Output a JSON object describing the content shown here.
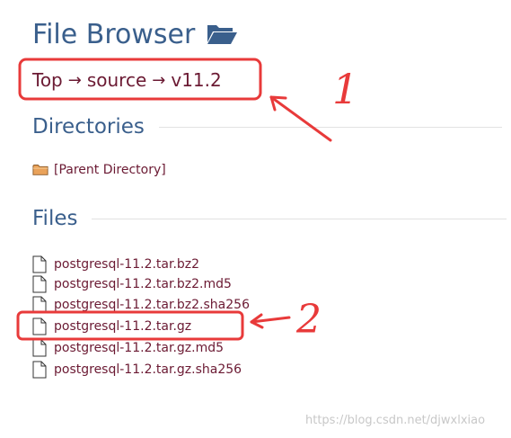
{
  "header": {
    "title": "File Browser",
    "folder_icon": "folder-open-icon",
    "title_color": "#3a5f8c"
  },
  "breadcrumb": {
    "items": [
      "Top",
      "source",
      "v11.2"
    ],
    "separator": "→",
    "link_color": "#6b1a33"
  },
  "directories": {
    "heading": "Directories",
    "items": [
      {
        "label": "[Parent Directory]",
        "icon": "folder-icon"
      }
    ]
  },
  "files": {
    "heading": "Files",
    "items": [
      {
        "label": "postgresql-11.2.tar.bz2",
        "icon": "file-icon"
      },
      {
        "label": "postgresql-11.2.tar.bz2.md5",
        "icon": "file-icon"
      },
      {
        "label": "postgresql-11.2.tar.bz2.sha256",
        "icon": "file-icon"
      },
      {
        "label": "postgresql-11.2.tar.gz",
        "icon": "file-icon"
      },
      {
        "label": "postgresql-11.2.tar.gz.md5",
        "icon": "file-icon"
      },
      {
        "label": "postgresql-11.2.tar.gz.sha256",
        "icon": "file-icon"
      }
    ]
  },
  "annotations": {
    "color": "#e83a3a",
    "marks": [
      "1",
      "2"
    ]
  },
  "watermark": "https://blog.csdn.net/djwxlxiao"
}
